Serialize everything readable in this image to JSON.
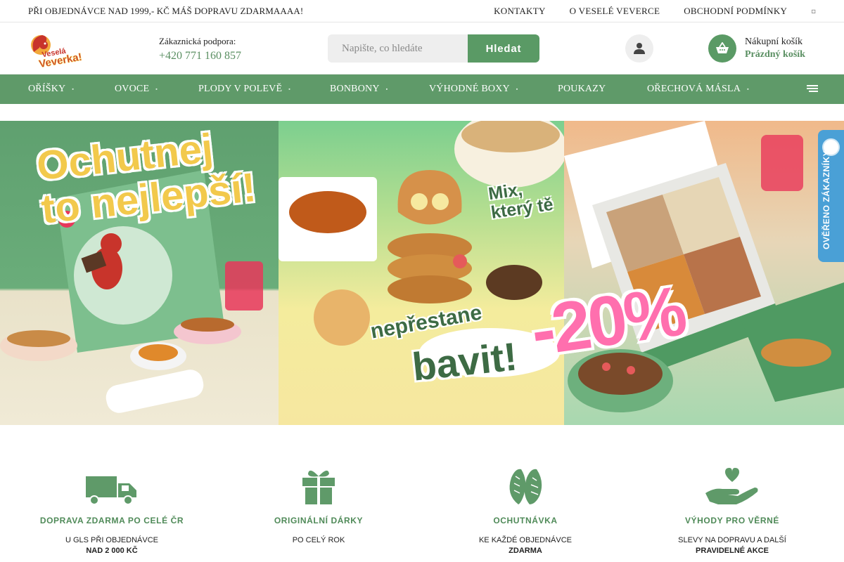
{
  "topbar": {
    "promo": "PŘI OBJEDNÁVCE NAD 1999,- KČ MÁŠ DOPRAVU ZDARMAAAA!",
    "links": [
      "KONTAKTY",
      "O VESELÉ VEVERCE",
      "OBCHODNÍ PODMÍNKY"
    ]
  },
  "header": {
    "logo_text": "Veselá Veverka!",
    "support_label": "Zákaznická podpora:",
    "support_phone": "+420 771 160 857",
    "search_placeholder": "Napište, co hledáte",
    "search_button": "Hledat",
    "cart_title": "Nákupní košík",
    "cart_status": "Prázdný košík"
  },
  "nav": {
    "items": [
      {
        "label": "OŘÍŠKY",
        "caret": true
      },
      {
        "label": "OVOCE",
        "caret": true
      },
      {
        "label": "PLODY V POLEVĚ",
        "caret": true
      },
      {
        "label": "BONBONY",
        "caret": true
      },
      {
        "label": "VÝHODNÉ BOXY",
        "caret": true
      },
      {
        "label": "POUKAZY",
        "caret": false
      },
      {
        "label": "OŘECHOVÁ MÁSLA",
        "caret": true
      }
    ]
  },
  "hero": {
    "panel1_line1": "Ochutnej",
    "panel1_line2": "to nejlepší!",
    "panel2_mix_line1": "Mix,",
    "panel2_mix_line2": "který tě",
    "panel2_nepr": "nepřestane",
    "panel2_bavit": "bavit!",
    "discount": "-20%"
  },
  "badge": {
    "label": "OVĚŘENO ZÁKAZNÍKY"
  },
  "features": [
    {
      "icon": "truck-icon",
      "title": "DOPRAVA ZDARMA PO CELÉ ČR",
      "sub1": "U GLS PŘI OBJEDNÁVCE",
      "sub2": "NAD 2 000 KČ"
    },
    {
      "icon": "gift-icon",
      "title": "ORIGINÁLNÍ DÁRKY",
      "sub1": "PO CELÝ ROK",
      "sub2": ""
    },
    {
      "icon": "almond-icon",
      "title": "OCHUTNÁVKA",
      "sub1": "KE KAŽDÉ OBJEDNÁVCE",
      "sub2": "ZDARMA"
    },
    {
      "icon": "heart-hand-icon",
      "title": "VÝHODY PRO VĚRNÉ",
      "sub1": "SLEVY NA DOPRAVU A DALŠÍ",
      "sub2": "PRAVIDELNÉ AKCE"
    }
  ],
  "colors": {
    "brand_green": "#5f9a69",
    "accent_pink": "#ff6fae",
    "badge_blue": "#4aa0d6"
  }
}
